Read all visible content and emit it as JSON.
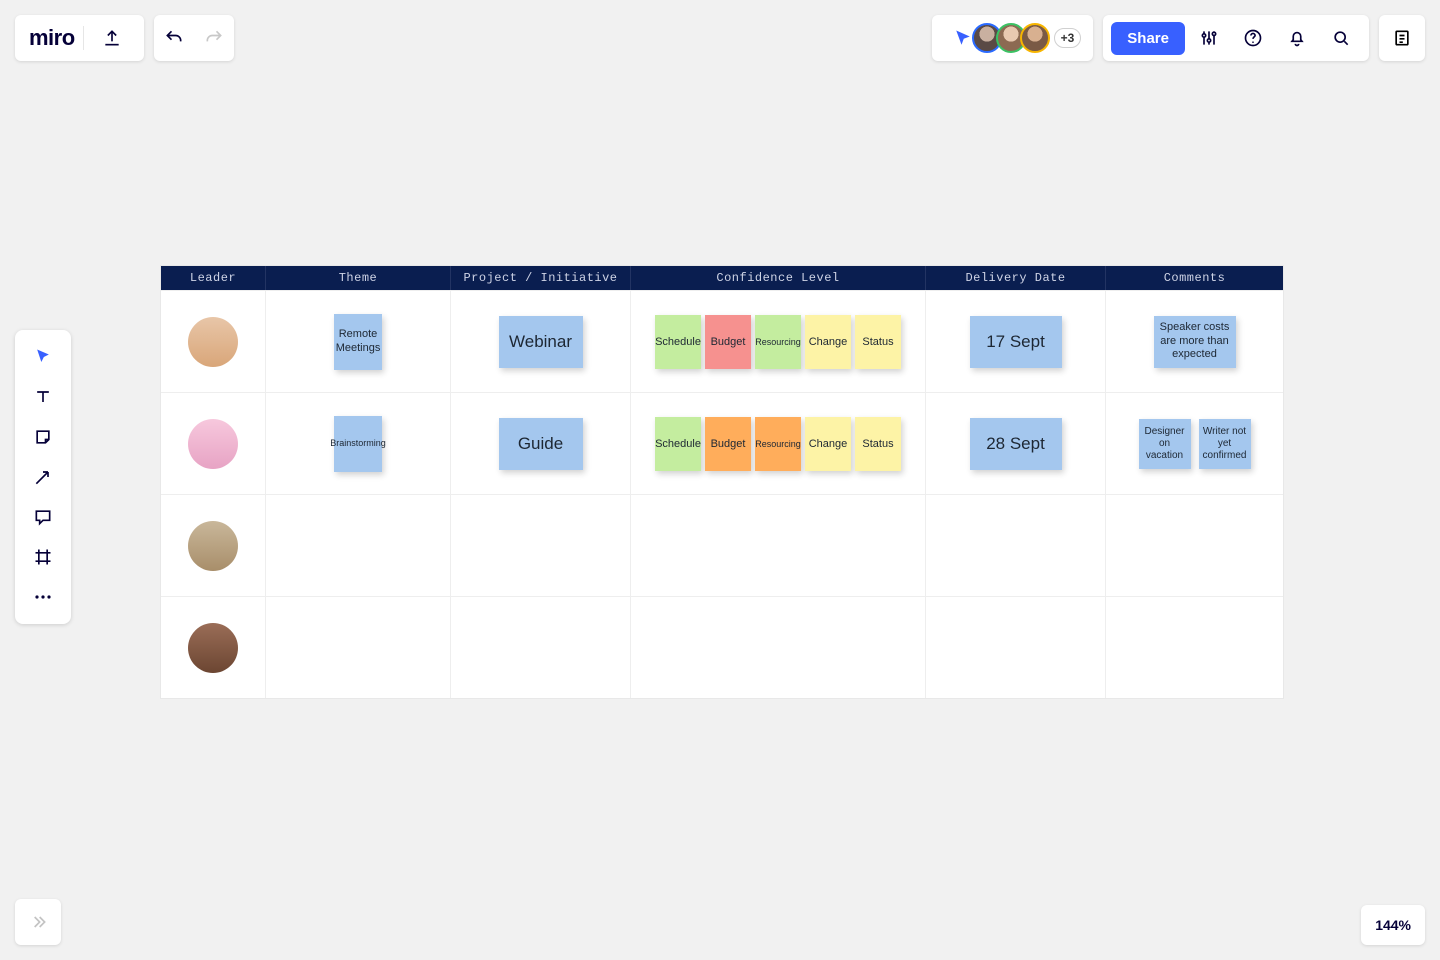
{
  "logo_text": "miro",
  "share_label": "Share",
  "extra_users_label": "+3",
  "zoom_label": "144%",
  "avatar_borders": [
    "#2a6aff",
    "#3bc264",
    "#f7b500",
    "#cfcfcf"
  ],
  "table": {
    "headers": {
      "leader": "Leader",
      "theme": "Theme",
      "project": "Project / Initiative",
      "confidence": "Confidence Level",
      "date": "Delivery Date",
      "comments": "Comments"
    },
    "rows": [
      {
        "theme": "Remote Meetings",
        "project": "Webinar",
        "confidence": [
          {
            "label": "Schedule",
            "cls": "s-green"
          },
          {
            "label": "Budget",
            "cls": "s-red"
          },
          {
            "label": "Resourcing",
            "cls": "s-green"
          },
          {
            "label": "Change",
            "cls": "s-yellow"
          },
          {
            "label": "Status",
            "cls": "s-yellow"
          }
        ],
        "date": "17 Sept",
        "comments": [
          {
            "text": "Speaker costs are more than expected",
            "size": "comment"
          }
        ]
      },
      {
        "theme": "Brainstorming",
        "project": "Guide",
        "confidence": [
          {
            "label": "Schedule",
            "cls": "s-green"
          },
          {
            "label": "Budget",
            "cls": "s-orange"
          },
          {
            "label": "Resourcing",
            "cls": "s-orange"
          },
          {
            "label": "Change",
            "cls": "s-yellow"
          },
          {
            "label": "Status",
            "cls": "s-yellow"
          }
        ],
        "date": "28 Sept",
        "comments": [
          {
            "text": "Designer on vacation",
            "size": "comment-sm"
          },
          {
            "text": "Writer not yet confirmed",
            "size": "comment-sm"
          }
        ]
      },
      {
        "theme": "",
        "project": "",
        "confidence": [],
        "date": "",
        "comments": []
      },
      {
        "theme": "",
        "project": "",
        "confidence": [],
        "date": "",
        "comments": []
      }
    ]
  }
}
